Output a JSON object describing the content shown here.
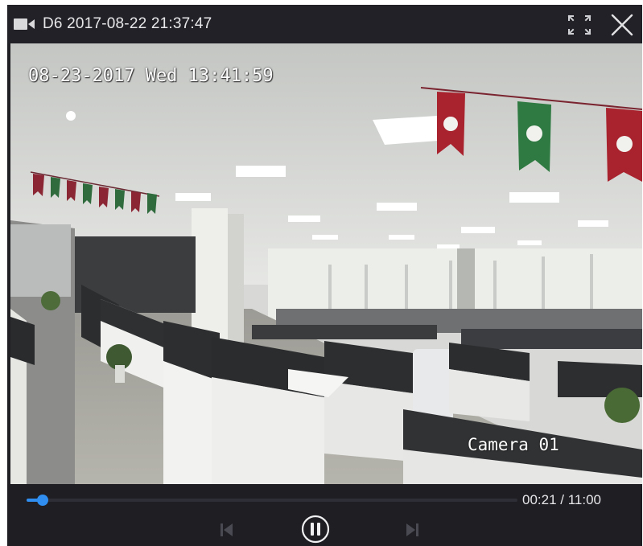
{
  "window": {
    "title": "D6 2017-08-22 21:37:47",
    "camera_icon": "video-camera-icon",
    "fullscreen_icon": "fullscreen-icon",
    "close_icon": "close-icon"
  },
  "video": {
    "osd_timestamp": "08-23-2017 Wed 13:41:59",
    "osd_camera_label": "Camera 01"
  },
  "playback": {
    "time_readout": "00:21 / 11:00",
    "progress_fraction": 0.032,
    "controls": {
      "previous_icon": "skip-previous-icon",
      "pause_icon": "pause-icon",
      "next_icon": "skip-next-icon"
    },
    "accent_color": "#2f8ef0",
    "disabled_color": "#4a4b52"
  }
}
